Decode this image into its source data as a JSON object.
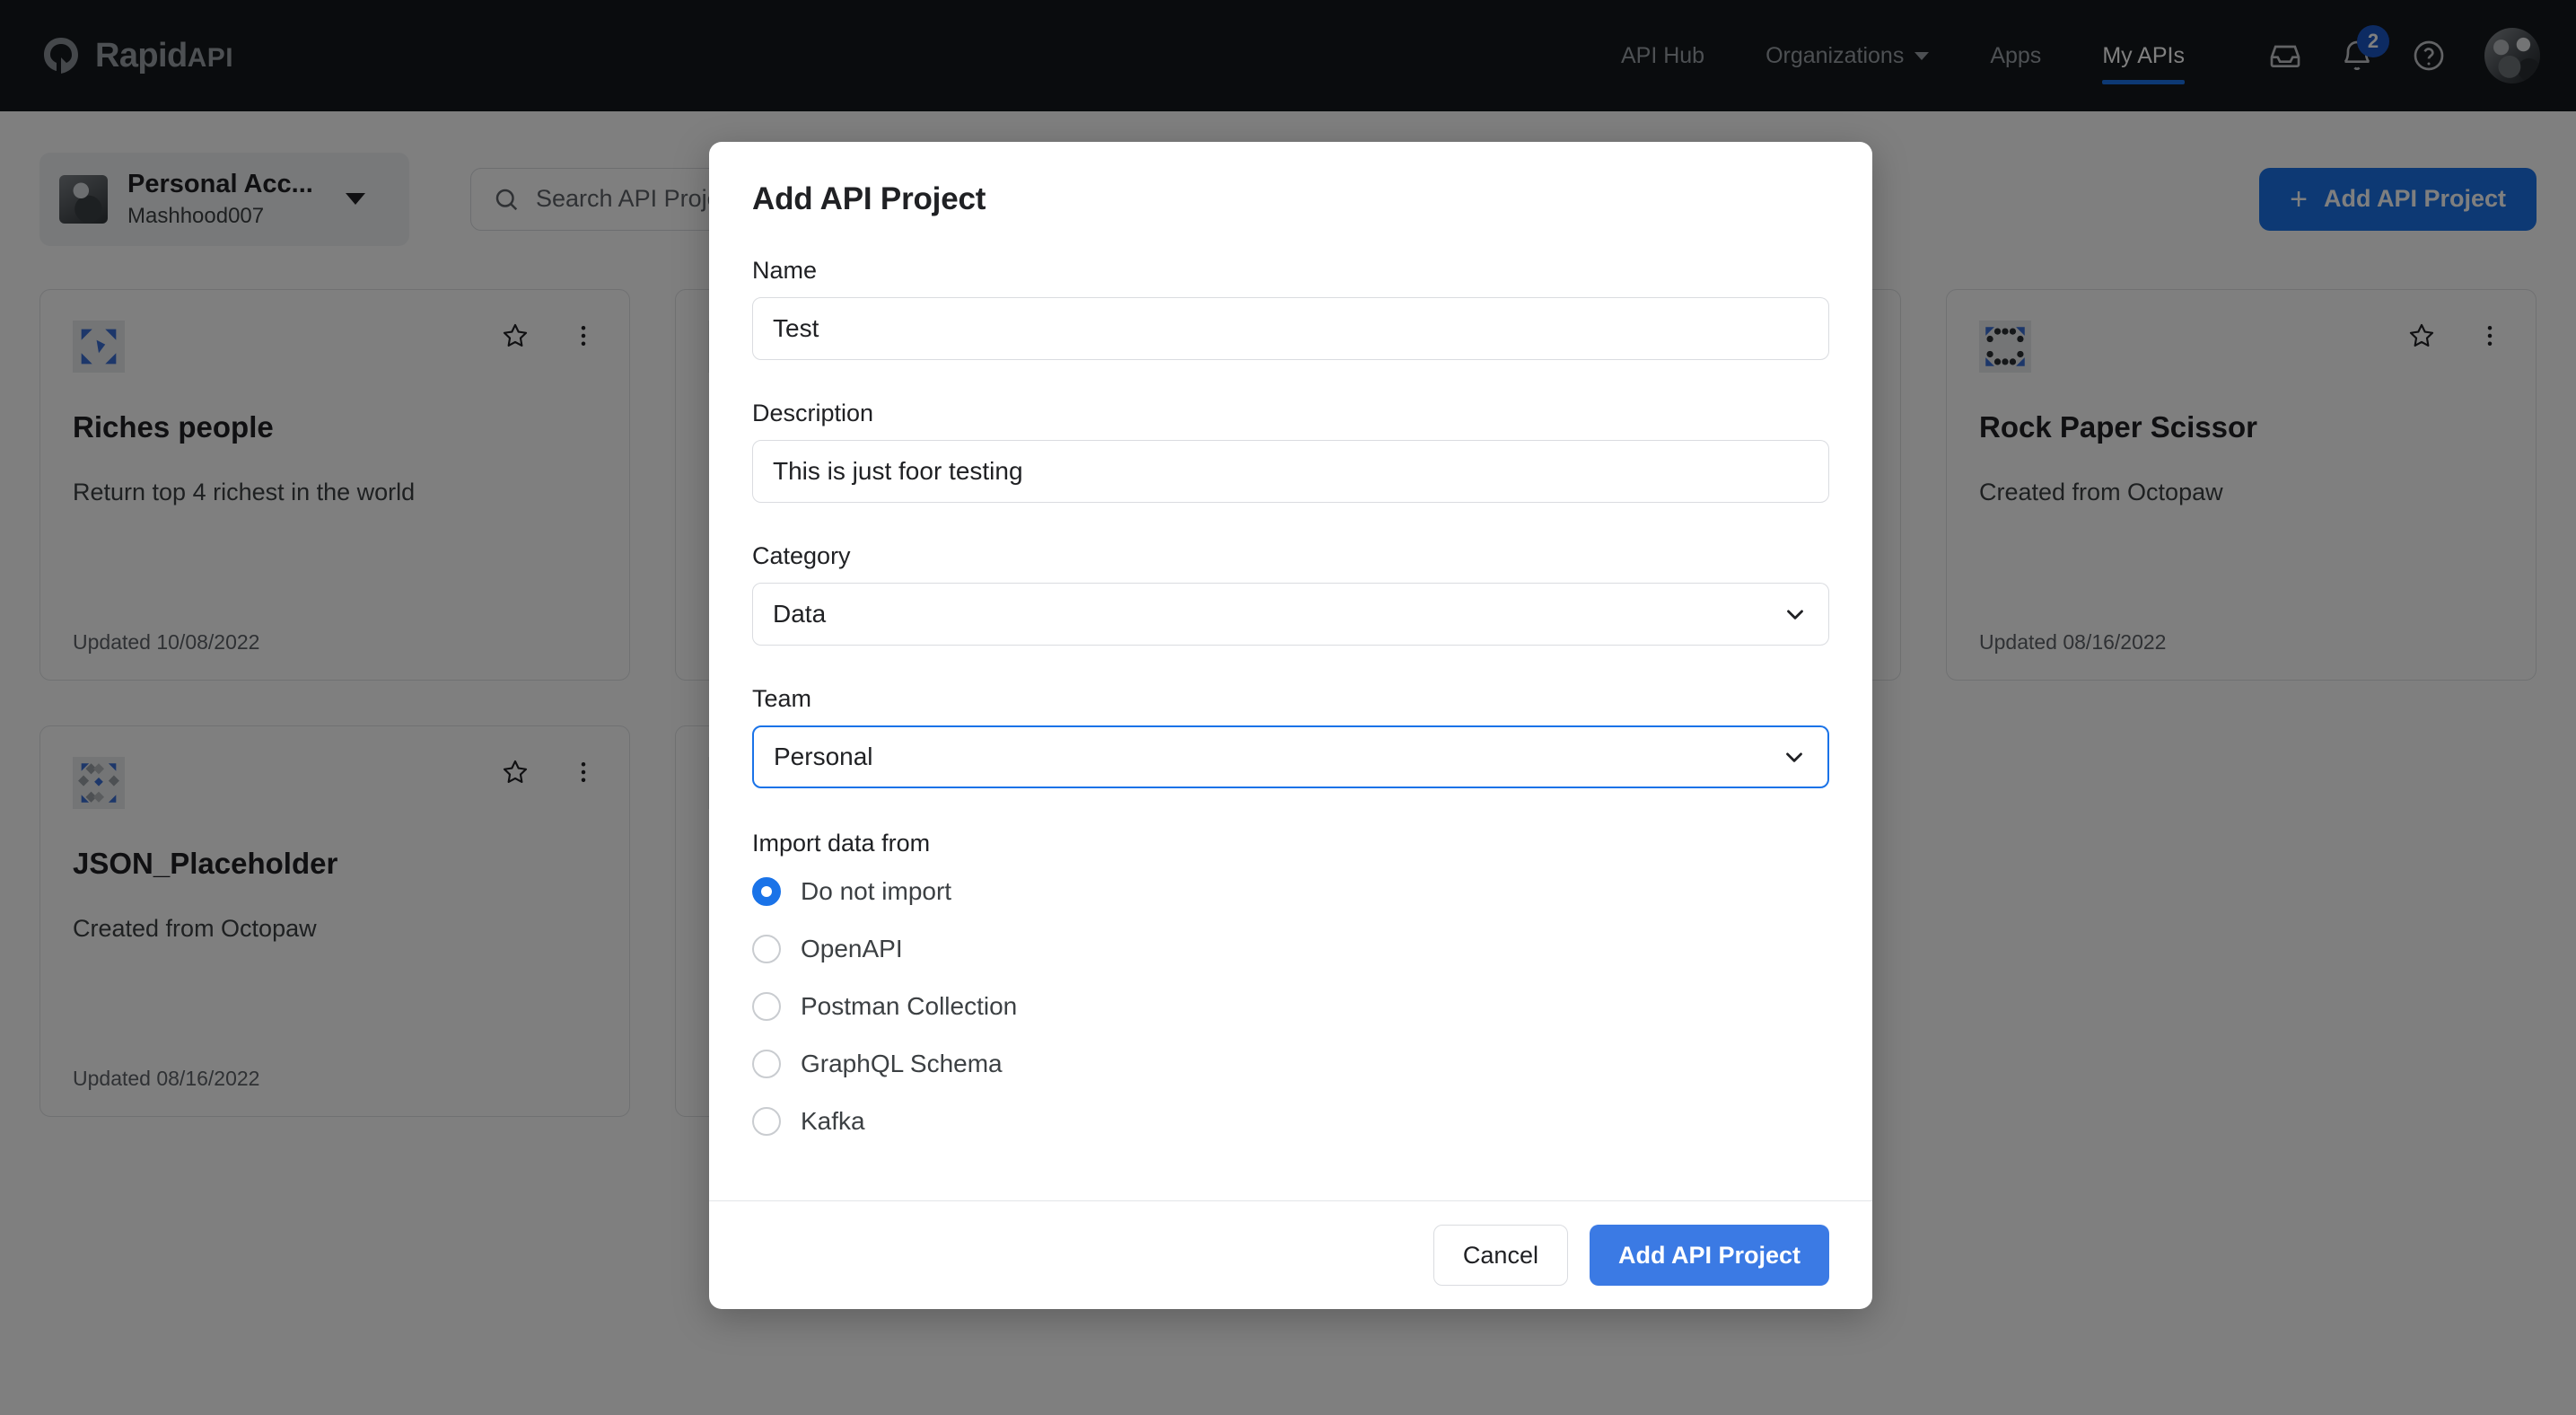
{
  "brand": {
    "name": "Rapid",
    "suffix": "API"
  },
  "topnav": {
    "links": [
      {
        "label": "API Hub",
        "active": false,
        "chevron": false
      },
      {
        "label": "Organizations",
        "active": false,
        "chevron": true
      },
      {
        "label": "Apps",
        "active": false,
        "chevron": false
      },
      {
        "label": "My APIs",
        "active": true,
        "chevron": false
      }
    ],
    "icons": [
      {
        "name": "inbox-icon"
      },
      {
        "name": "bell-icon",
        "badge": "2"
      },
      {
        "name": "help-icon"
      }
    ],
    "avatar": "user-avatar"
  },
  "toolbar": {
    "account_name": "Personal Acc...",
    "account_user": "Mashhood007",
    "search_placeholder": "Search API Projects",
    "add_button": "Add API Project",
    "add_icon": "plus-icon"
  },
  "cards": [
    {
      "title": "Riches people",
      "description": "Return top 4 richest in the world",
      "updated": "Updated 10/08/2022"
    },
    {
      "title": "",
      "description": "",
      "updated": ""
    },
    {
      "title": "",
      "description": "",
      "updated": ""
    },
    {
      "title": "Rock Paper Scissor",
      "description": "Created from Octopaw",
      "updated": "Updated 08/16/2022"
    },
    {
      "title": "JSON_Placeholder",
      "description": "Created from Octopaw",
      "updated": "Updated 08/16/2022"
    },
    {
      "title": "",
      "description": "",
      "updated": ""
    }
  ],
  "modal": {
    "title": "Add API Project",
    "name_label": "Name",
    "name_value": "Test",
    "description_label": "Description",
    "description_value": "This is just foor testing",
    "category_label": "Category",
    "category_value": "Data",
    "team_label": "Team",
    "team_value": "Personal",
    "import_label": "Import data from",
    "import_options": [
      {
        "label": "Do not import",
        "checked": true
      },
      {
        "label": "OpenAPI",
        "checked": false
      },
      {
        "label": "Postman Collection",
        "checked": false
      },
      {
        "label": "GraphQL Schema",
        "checked": false
      },
      {
        "label": "Kafka",
        "checked": false
      }
    ],
    "cancel_label": "Cancel",
    "submit_label": "Add API Project"
  },
  "colors": {
    "accent": "#1a73e8",
    "primary_button": "#3b7ae4",
    "nav_background": "#15191c",
    "overlay": "rgba(0,0,0,0.5)"
  }
}
